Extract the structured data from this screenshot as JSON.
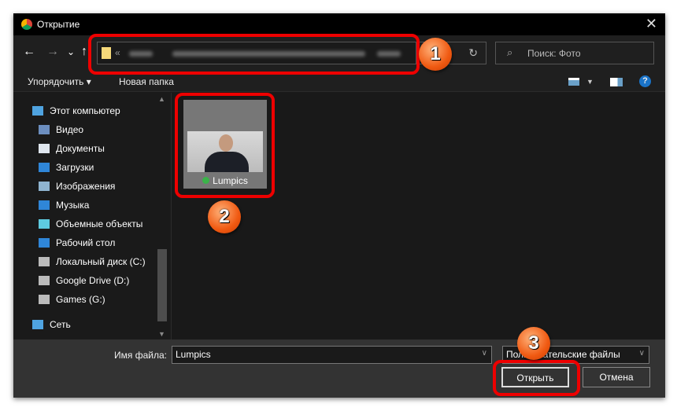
{
  "window": {
    "title": "Открытие",
    "close": "✕"
  },
  "nav": {
    "back": "←",
    "forward": "→",
    "recent": "⌄",
    "up": "↑",
    "address_prefix": "«",
    "refresh": "↻",
    "search_placeholder": "Поиск: Фото"
  },
  "toolbar": {
    "organize": "Упорядочить ▾",
    "new_folder": "Новая папка",
    "help": "?"
  },
  "sidebar": {
    "items": [
      {
        "label": "Этот компьютер",
        "icon": "computer-icon",
        "color": "#4fa3e0"
      },
      {
        "label": "Видео",
        "icon": "video-icon",
        "color": "#6c8ebf"
      },
      {
        "label": "Документы",
        "icon": "documents-icon",
        "color": "#dfe6ee"
      },
      {
        "label": "Загрузки",
        "icon": "downloads-icon",
        "color": "#2f86d8"
      },
      {
        "label": "Изображения",
        "icon": "pictures-icon",
        "color": "#8fb4d0"
      },
      {
        "label": "Музыка",
        "icon": "music-icon",
        "color": "#2f86d8"
      },
      {
        "label": "Объемные объекты",
        "icon": "3d-objects-icon",
        "color": "#5ecbe0"
      },
      {
        "label": "Рабочий стол",
        "icon": "desktop-icon",
        "color": "#2f86d8"
      },
      {
        "label": "Локальный диск (C:)",
        "icon": "drive-icon",
        "color": "#bbbbbb"
      },
      {
        "label": "Google Drive (D:)",
        "icon": "drive-icon",
        "color": "#bbbbbb"
      },
      {
        "label": "Games (G:)",
        "icon": "drive-icon",
        "color": "#bbbbbb"
      },
      {
        "label": "Сеть",
        "icon": "network-icon",
        "color": "#4fa3e0"
      }
    ]
  },
  "files": [
    {
      "name": "Lumpics"
    }
  ],
  "bottom": {
    "filename_label": "Имя файла:",
    "filename_value": "Lumpics",
    "filetype": "Пользовательские файлы",
    "open": "Открыть",
    "cancel": "Отмена"
  },
  "annotations": [
    "1",
    "2",
    "3"
  ],
  "colors": {
    "highlight": "#ee0000",
    "badge": "#f05a12"
  }
}
